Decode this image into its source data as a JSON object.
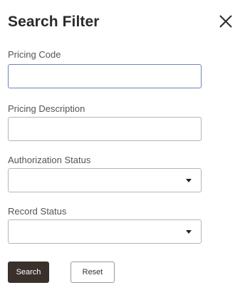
{
  "dialog": {
    "title": "Search Filter"
  },
  "fields": {
    "pricing_code": {
      "label": "Pricing Code",
      "value": "",
      "placeholder": ""
    },
    "pricing_description": {
      "label": "Pricing Description",
      "value": "",
      "placeholder": ""
    },
    "authorization_status": {
      "label": "Authorization Status",
      "selected": ""
    },
    "record_status": {
      "label": "Record Status",
      "selected": ""
    }
  },
  "actions": {
    "search_label": "Search",
    "reset_label": "Reset"
  },
  "icons": {
    "close": "close-icon",
    "dropdown": "chevron-down-icon"
  },
  "colors": {
    "primary_button": "#3a312c",
    "focus_border": "#6f83b5"
  }
}
